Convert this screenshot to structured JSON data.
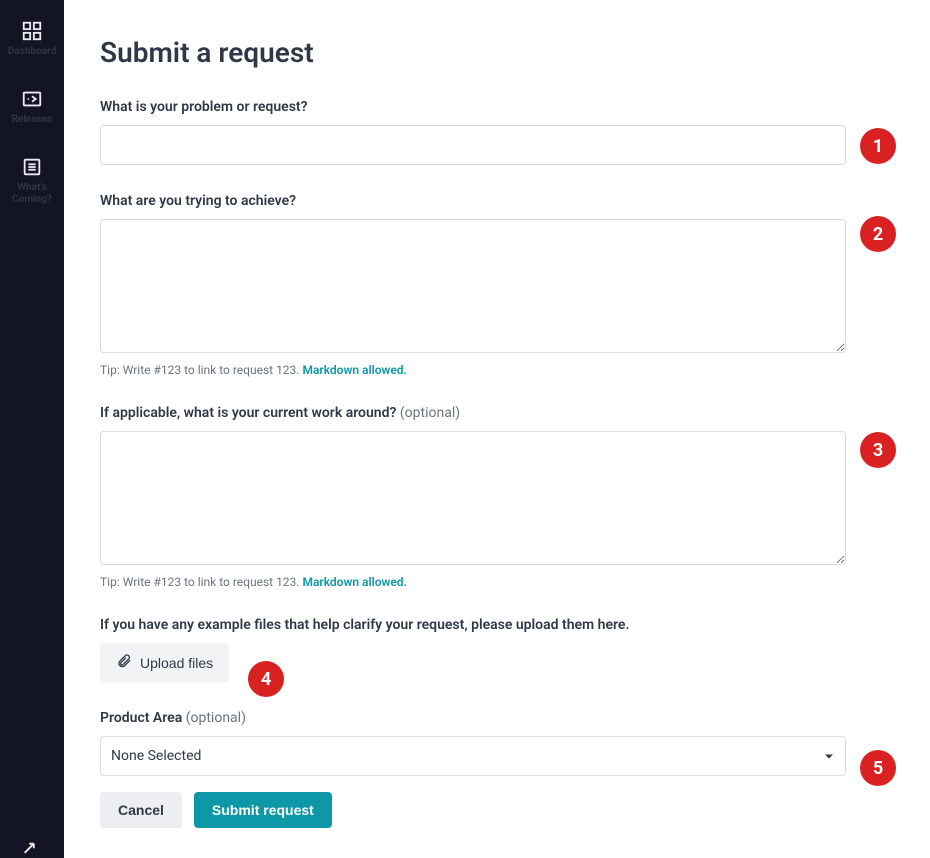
{
  "sidebar": {
    "items": [
      {
        "label": "Dashboard"
      },
      {
        "label": "Releases"
      },
      {
        "label": "What's Coming?"
      }
    ]
  },
  "page": {
    "title": "Submit a request"
  },
  "fields": {
    "problem": {
      "label": "What is your problem or request?",
      "value": ""
    },
    "achieve": {
      "label": "What are you trying to achieve?",
      "value": "",
      "hint_prefix": "Tip: Write #123 to link to request 123. ",
      "hint_link": "Markdown allowed."
    },
    "workaround": {
      "label_main": "If applicable, what is your current work around?",
      "label_optional": " (optional)",
      "value": "",
      "hint_prefix": "Tip: Write #123 to link to request 123. ",
      "hint_link": "Markdown allowed."
    },
    "upload": {
      "label": "If you have any example files that help clarify your request, please upload them here.",
      "button": "Upload files"
    },
    "product_area": {
      "label_main": "Product Area",
      "label_optional": " (optional)",
      "selected": "None Selected"
    }
  },
  "actions": {
    "cancel": "Cancel",
    "submit": "Submit request"
  },
  "callouts": [
    "1",
    "2",
    "3",
    "4",
    "5"
  ]
}
